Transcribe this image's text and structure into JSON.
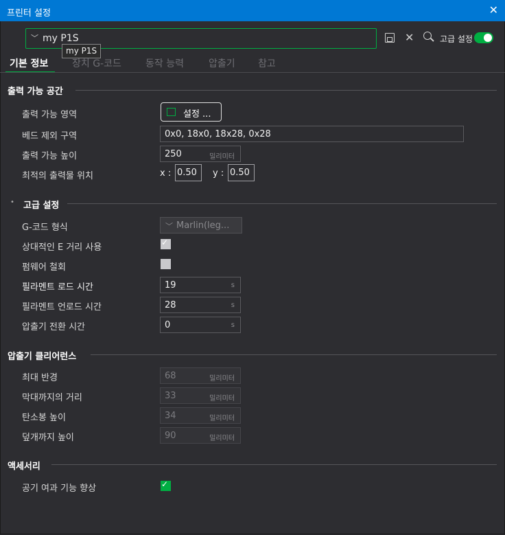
{
  "window": {
    "title": "프린터 설정"
  },
  "preset": {
    "name": "my P1S",
    "tooltip": "my P1S"
  },
  "toolbar": {
    "advanced_label": "고급 설정"
  },
  "tabs": [
    {
      "label": "기본 정보"
    },
    {
      "label": "장치 G-코드"
    },
    {
      "label": "동작 능력"
    },
    {
      "label": "압출기"
    },
    {
      "label": "참고"
    }
  ],
  "printable_space": {
    "title": "출력 가능 공간",
    "area_label": "출력 가능 영역",
    "setup_button": "설정 ...",
    "bed_exclude_label": "베드 제외 구역",
    "bed_exclude_value": "0x0, 18x0, 18x28, 0x28",
    "height_label": "출력 가능 높이",
    "height_value": "250",
    "height_unit": "밀리미터",
    "position_label": "최적의 출력물 위치",
    "x_label": "x :",
    "x_value": "0.50",
    "y_label": "y :",
    "y_value": "0.50"
  },
  "advanced": {
    "bullet": "•",
    "title": "고급 설정",
    "gcode_label": "G-코드 형식",
    "gcode_value": "Marlin(leg...",
    "relative_e_label": "상대적인 E 거리 사용",
    "relative_e_checked": true,
    "fw_retract_label": "펌웨어 철회",
    "fw_retract_checked": false,
    "load_time_label": "필라멘트 로드 시간",
    "load_time_value": "19",
    "unload_time_label": "필라멘트 언로드 시간",
    "unload_time_value": "28",
    "change_time_label": "압출기 전환 시간",
    "change_time_value": "0",
    "time_unit": "s"
  },
  "clearance": {
    "title": "압출기 클리어런스",
    "radius_label": "최대 반경",
    "radius_value": "68",
    "rod_label": "막대까지의 거리",
    "rod_value": "33",
    "carbon_label": "탄소봉 높이",
    "carbon_value": "34",
    "lid_label": "덮개까지 높이",
    "lid_value": "90",
    "unit": "밀리미터"
  },
  "accessory": {
    "title": "액세서리",
    "air_filter_label": "공기 여과 기능 향상",
    "air_filter_checked": true
  },
  "colors": {
    "accent": "#00ae42",
    "titlebar": "#0078d4",
    "background": "#2d2d31"
  }
}
